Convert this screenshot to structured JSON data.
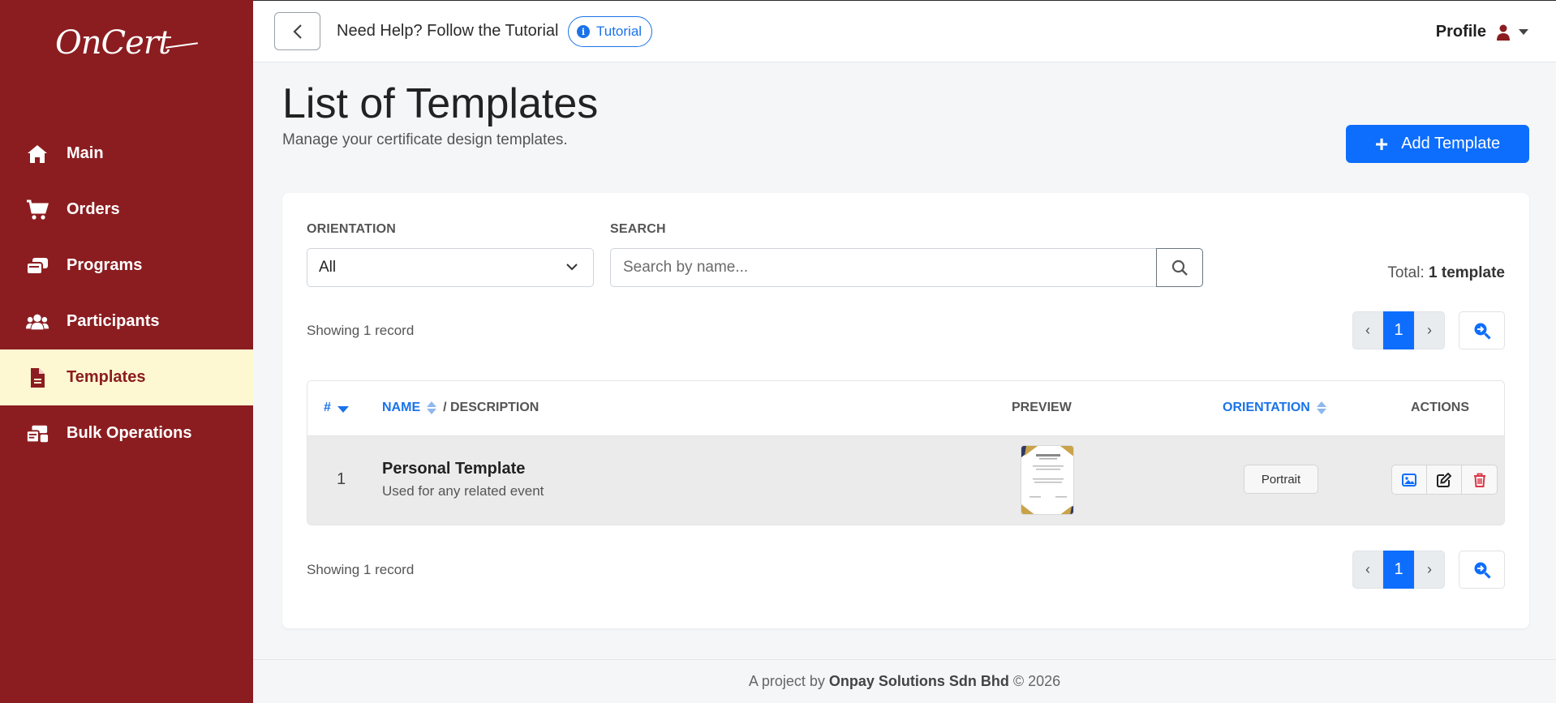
{
  "sidebar": {
    "logo": "OnCert",
    "items": [
      {
        "label": "Main",
        "icon": "home-icon"
      },
      {
        "label": "Orders",
        "icon": "cart-icon"
      },
      {
        "label": "Programs",
        "icon": "programs-icon"
      },
      {
        "label": "Participants",
        "icon": "users-icon"
      },
      {
        "label": "Templates",
        "icon": "file-icon",
        "active": true
      },
      {
        "label": "Bulk Operations",
        "icon": "bulk-icon"
      }
    ]
  },
  "topbar": {
    "help_text": "Need Help? Follow the Tutorial",
    "tutorial_label": "Tutorial",
    "profile_label": "Profile"
  },
  "header": {
    "title": "List of Templates",
    "subtitle": "Manage your certificate design templates.",
    "add_button": "Add Template"
  },
  "filters": {
    "orientation_label": "ORIENTATION",
    "orientation_value": "All",
    "search_label": "SEARCH",
    "search_placeholder": "Search by name..."
  },
  "summary": {
    "total_prefix": "Total:",
    "total_value": "1 template",
    "showing_top": "Showing 1 record",
    "showing_bottom": "Showing 1 record",
    "prev": "‹",
    "current_page": "1",
    "next": "›"
  },
  "table": {
    "headers": {
      "num": "#",
      "name": "NAME",
      "description": "/ DESCRIPTION",
      "preview": "PREVIEW",
      "orientation": "ORIENTATION",
      "actions": "ACTIONS"
    },
    "rows": [
      {
        "num": "1",
        "name": "Personal Template",
        "description": "Used for any related event",
        "orientation": "Portrait"
      }
    ]
  },
  "footer": {
    "prefix": "A project by",
    "company": "Onpay Solutions Sdn Bhd",
    "suffix": "© 2026"
  },
  "colors": {
    "sidebar_bg": "#8b1d20",
    "active_bg": "#fef8d2",
    "primary": "#0d6efd",
    "danger": "#dc3545"
  }
}
